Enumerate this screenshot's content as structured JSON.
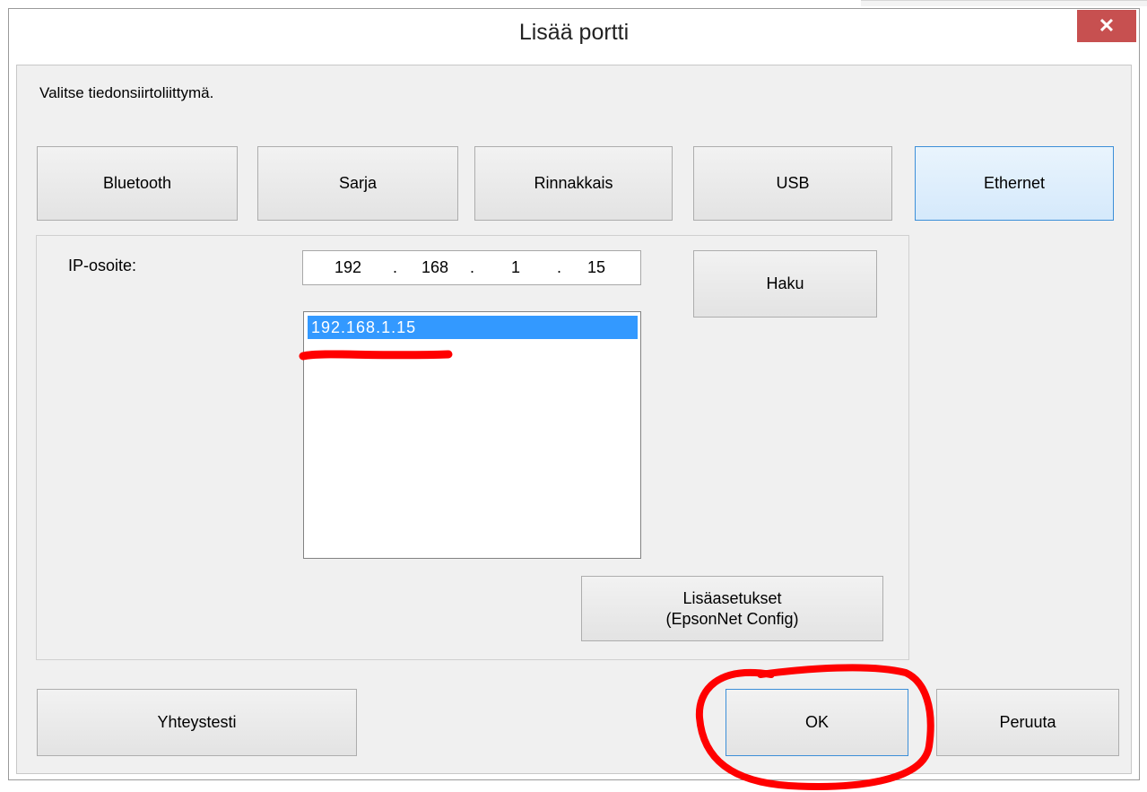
{
  "dialog": {
    "title": "Lisää portti",
    "close_label": "✕",
    "instruction": "Valitse tiedonsiirtoliittymä."
  },
  "interfaces": [
    {
      "label": "Bluetooth",
      "selected": false
    },
    {
      "label": "Sarja",
      "selected": false
    },
    {
      "label": "Rinnakkais",
      "selected": false
    },
    {
      "label": "USB",
      "selected": false
    },
    {
      "label": "Ethernet",
      "selected": true
    }
  ],
  "ethernet": {
    "ip_label": "IP-osoite:",
    "ip_octets": [
      "192",
      "168",
      "1",
      "15"
    ],
    "ip_separator": ".",
    "search_label": "Haku",
    "found_devices": [
      "192.168.1.15"
    ],
    "advanced_label_line1": "Lisäasetukset",
    "advanced_label_line2": "(EpsonNet Config)"
  },
  "footer": {
    "test_label": "Yhteystesti",
    "ok_label": "OK",
    "cancel_label": "Peruuta"
  },
  "colors": {
    "selection": "#3399ff",
    "annotation": "#ff0000",
    "close": "#c75050"
  }
}
